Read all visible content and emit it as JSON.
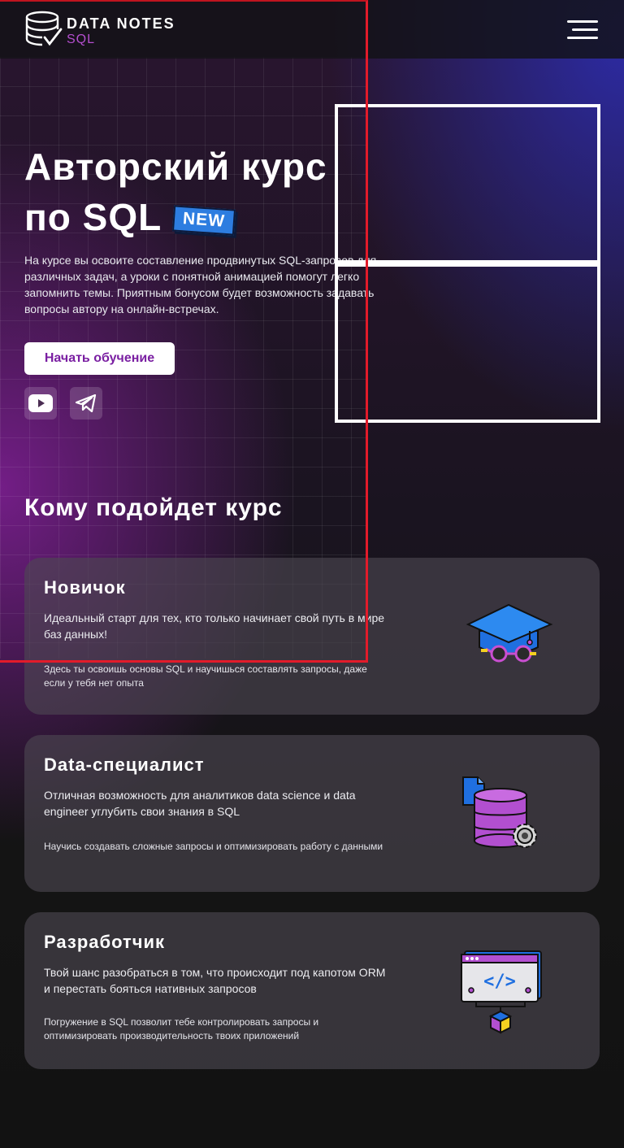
{
  "header": {
    "logo_main": "DATA NOTES",
    "logo_sub": "SQL",
    "menu_icon": "hamburger-menu-icon"
  },
  "hero": {
    "title_line1": "Авторский курс",
    "title_line2": "по SQL",
    "badge": "NEW",
    "description": "На курсе вы освоите составление продвинутых SQL-запросов для различных задач, а уроки с понятной анимацией помогут легко запомнить темы. Приятным бонусом будет возможность задавать вопросы автору на онлайн-встречах.",
    "cta_label": "Начать обучение",
    "social": [
      "youtube-icon",
      "telegram-icon"
    ]
  },
  "audience": {
    "title": "Кому подойдет курс",
    "cards": [
      {
        "title": "Новичок",
        "text": "Идеальный старт для тех, кто только начинает свой путь в мире баз данных!",
        "note": "Здесь ты освоишь основы SQL и научишься составлять запросы, даже если у тебя нет опыта",
        "icon": "graduation-cap-icon"
      },
      {
        "title": "Data-специалист",
        "text": "Отличная возможность для аналитиков data science и data engineer углубить свои знания в SQL",
        "note": "Научись создавать сложные запросы и оптимизировать работу с данными",
        "icon": "database-gear-icon"
      },
      {
        "title": "Разработчик",
        "text": "Твой шанс разобраться в том, что происходит под капотом ORM и перестать бояться нативных запросов",
        "note": "Погружение в SQL позволит тебе контролировать запросы и оптимизировать производительность твоих приложений",
        "icon": "code-window-icon"
      }
    ]
  },
  "colors": {
    "accent_purple": "#b44ecf",
    "cta_text": "#7a1fa2",
    "badge_blue": "#2d7de0"
  }
}
